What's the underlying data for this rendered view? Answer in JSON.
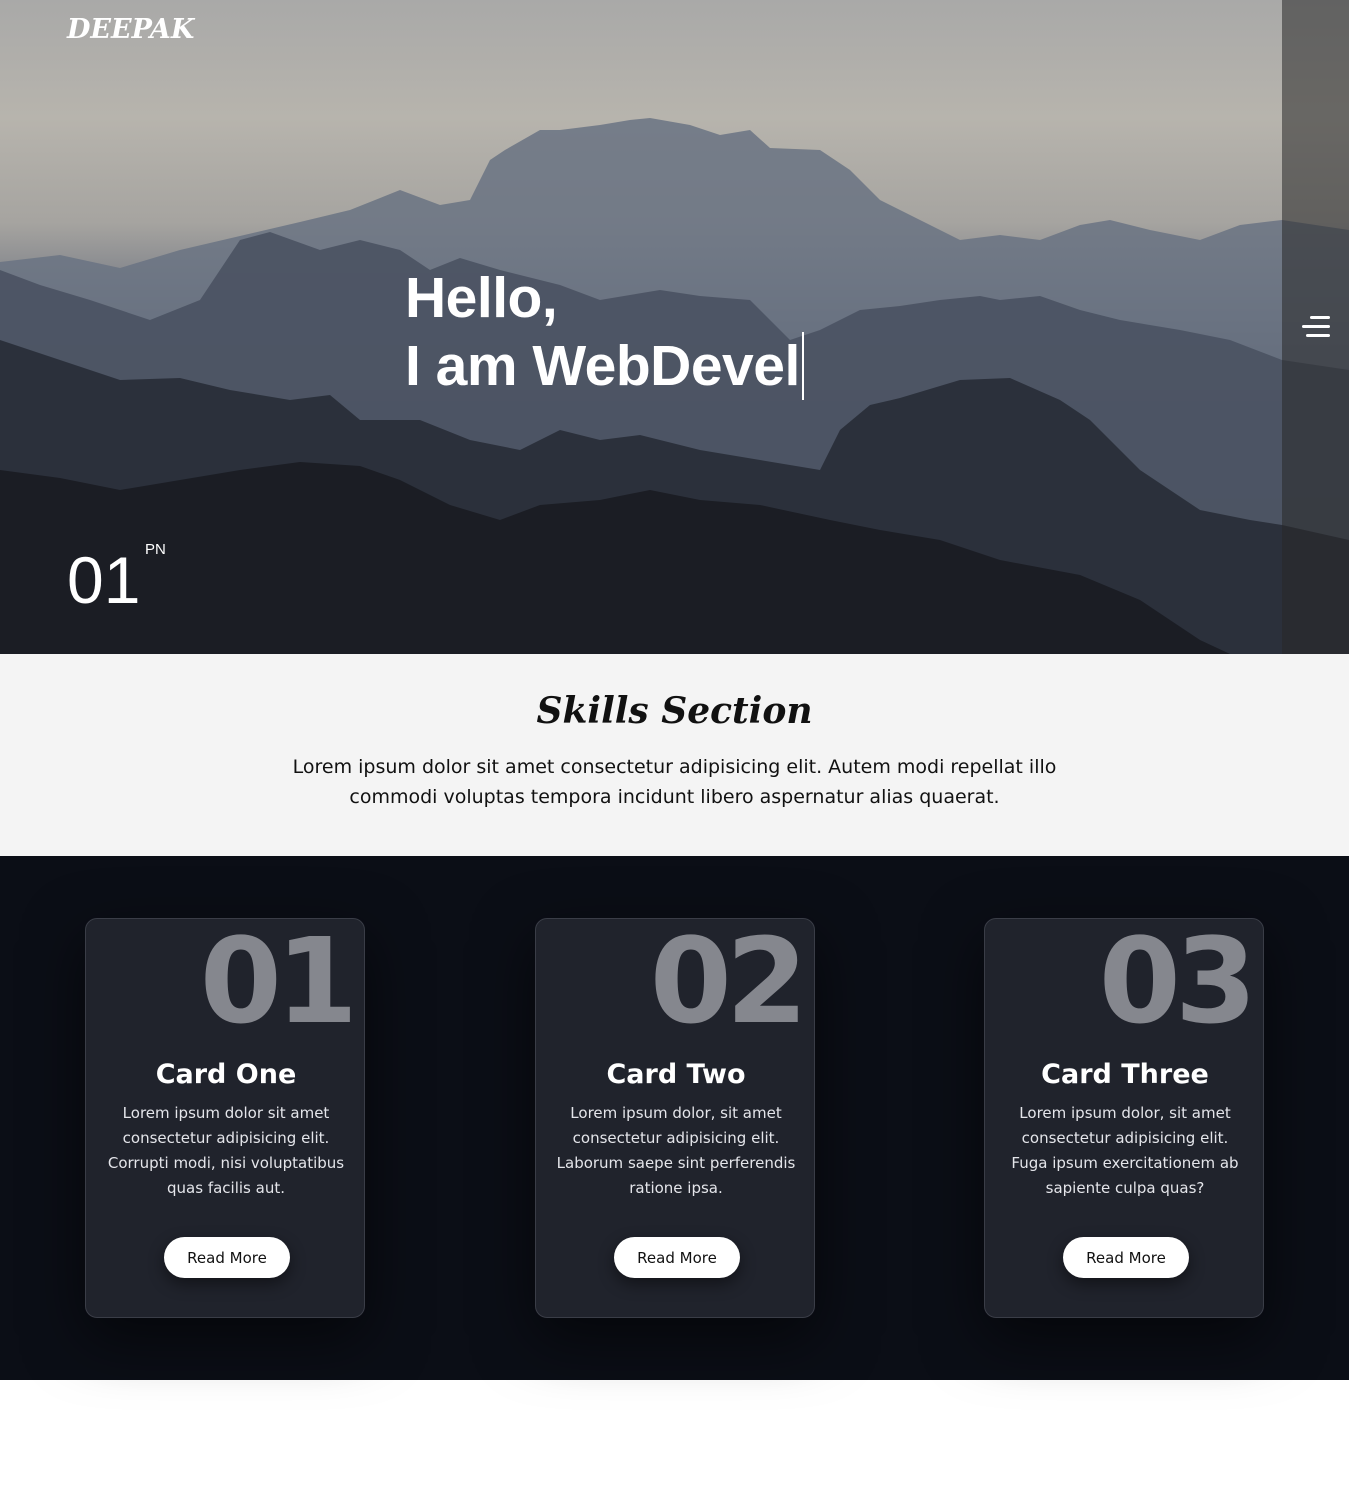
{
  "brand": {
    "logo": "DEEPAK"
  },
  "hero": {
    "greeting": "Hello,",
    "typed_text": "I am WebDevel",
    "slide_number": "01",
    "slide_superscript": "PN"
  },
  "menu": {
    "icon": "hamburger-menu-icon"
  },
  "skills": {
    "title": "Skills Section",
    "description": "Lorem ipsum dolor sit amet consectetur adipisicing elit. Autem modi repellat illo commodi voluptas tempora incidunt libero aspernatur alias quaerat."
  },
  "cards": [
    {
      "number": "01",
      "title": "Card One",
      "text": "Lorem ipsum dolor sit amet consectetur adipisicing elit. Corrupti modi, nisi voluptatibus quas facilis aut.",
      "button": "Read More"
    },
    {
      "number": "02",
      "title": "Card Two",
      "text": "Lorem ipsum dolor, sit amet consectetur adipisicing elit. Laborum saepe sint perferendis ratione ipsa.",
      "button": "Read More"
    },
    {
      "number": "03",
      "title": "Card Three",
      "text": "Lorem ipsum dolor, sit amet consectetur adipisicing elit. Fuga ipsum exercitationem ab sapiente culpa quas?",
      "button": "Read More"
    }
  ],
  "colors": {
    "cards_background": "#0b0e16",
    "card_surface": "#20232c",
    "card_number": "#85878e",
    "skills_background": "#f4f4f4"
  }
}
